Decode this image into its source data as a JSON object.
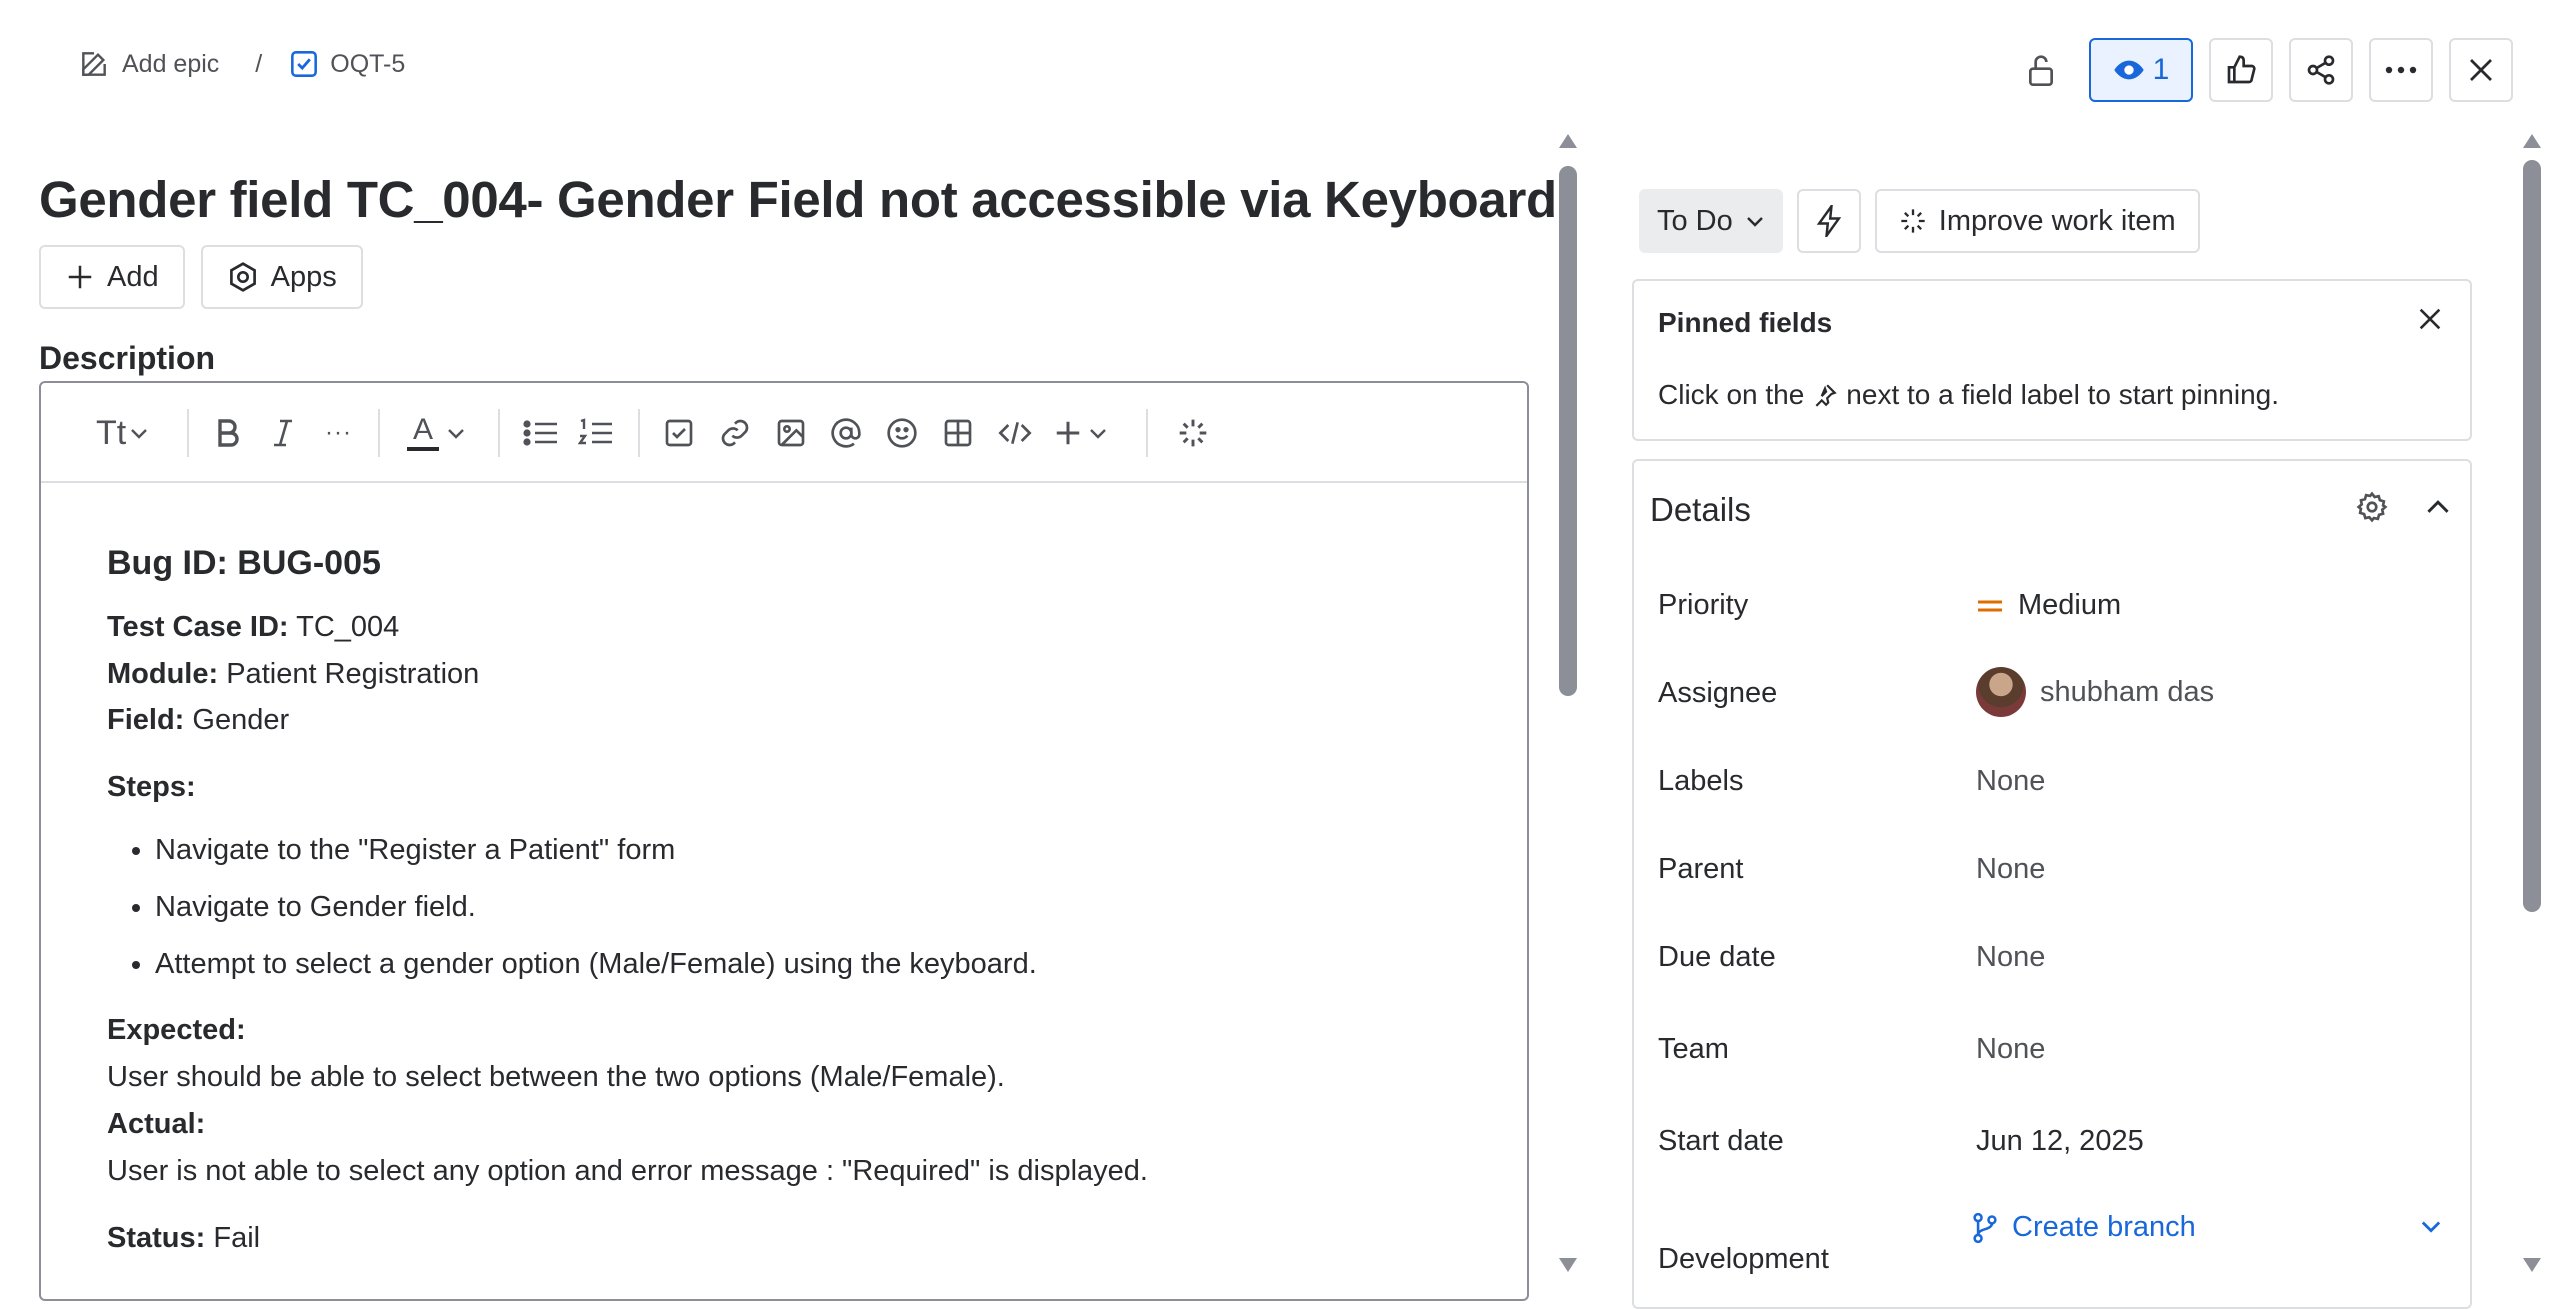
{
  "breadcrumb": {
    "epic_label": "Add epic",
    "separator": "/",
    "issue_key": "OQT-5"
  },
  "top_actions": {
    "watchers_count": "1"
  },
  "issue": {
    "title": "Gender field TC_004- Gender Field not accessible via Keyboard"
  },
  "actions": {
    "add_label": "Add",
    "apps_label": "Apps"
  },
  "description": {
    "label": "Description",
    "toolbar": {
      "text_style": "Tt",
      "more": "···",
      "text_color": "A"
    },
    "bug_heading": "Bug ID: BUG-005",
    "test_case_label": "Test Case ID:",
    "test_case_value": "TC_004",
    "module_label": "Module:",
    "module_value": "Patient Registration",
    "field_label": "Field:",
    "field_value": "Gender",
    "steps_label": "Steps:",
    "steps": [
      "Navigate to the \"Register a Patient\" form",
      "Navigate to Gender field.",
      "Attempt to select a gender option (Male/Female) using the keyboard."
    ],
    "expected_label": "Expected:",
    "expected_value": "User should be able to select between the two options (Male/Female).",
    "actual_label": "Actual:",
    "actual_value": "User is not able to select any option and error message : \"Required\" is displayed.",
    "status_label": "Status:",
    "status_value": "Fail"
  },
  "status": {
    "value": "To Do",
    "improve_label": "Improve work item"
  },
  "pinned": {
    "title": "Pinned fields",
    "msg_before": "Click on the",
    "msg_after": "next to a field label to start pinning."
  },
  "details": {
    "title": "Details",
    "fields": {
      "priority": {
        "label": "Priority",
        "value": "Medium"
      },
      "assignee": {
        "label": "Assignee",
        "value": "shubham das"
      },
      "labels": {
        "label": "Labels",
        "value": "None"
      },
      "parent": {
        "label": "Parent",
        "value": "None"
      },
      "due_date": {
        "label": "Due date",
        "value": "None"
      },
      "team": {
        "label": "Team",
        "value": "None"
      },
      "start_date": {
        "label": "Start date",
        "value": "Jun 12, 2025"
      },
      "development": {
        "label": "Development",
        "value": "Create branch"
      }
    }
  },
  "colors": {
    "accent": "#1868DB",
    "priority_medium": "#E06C00",
    "text": "#292A2E",
    "muted": "#505258",
    "border": "#DDDEE1"
  }
}
